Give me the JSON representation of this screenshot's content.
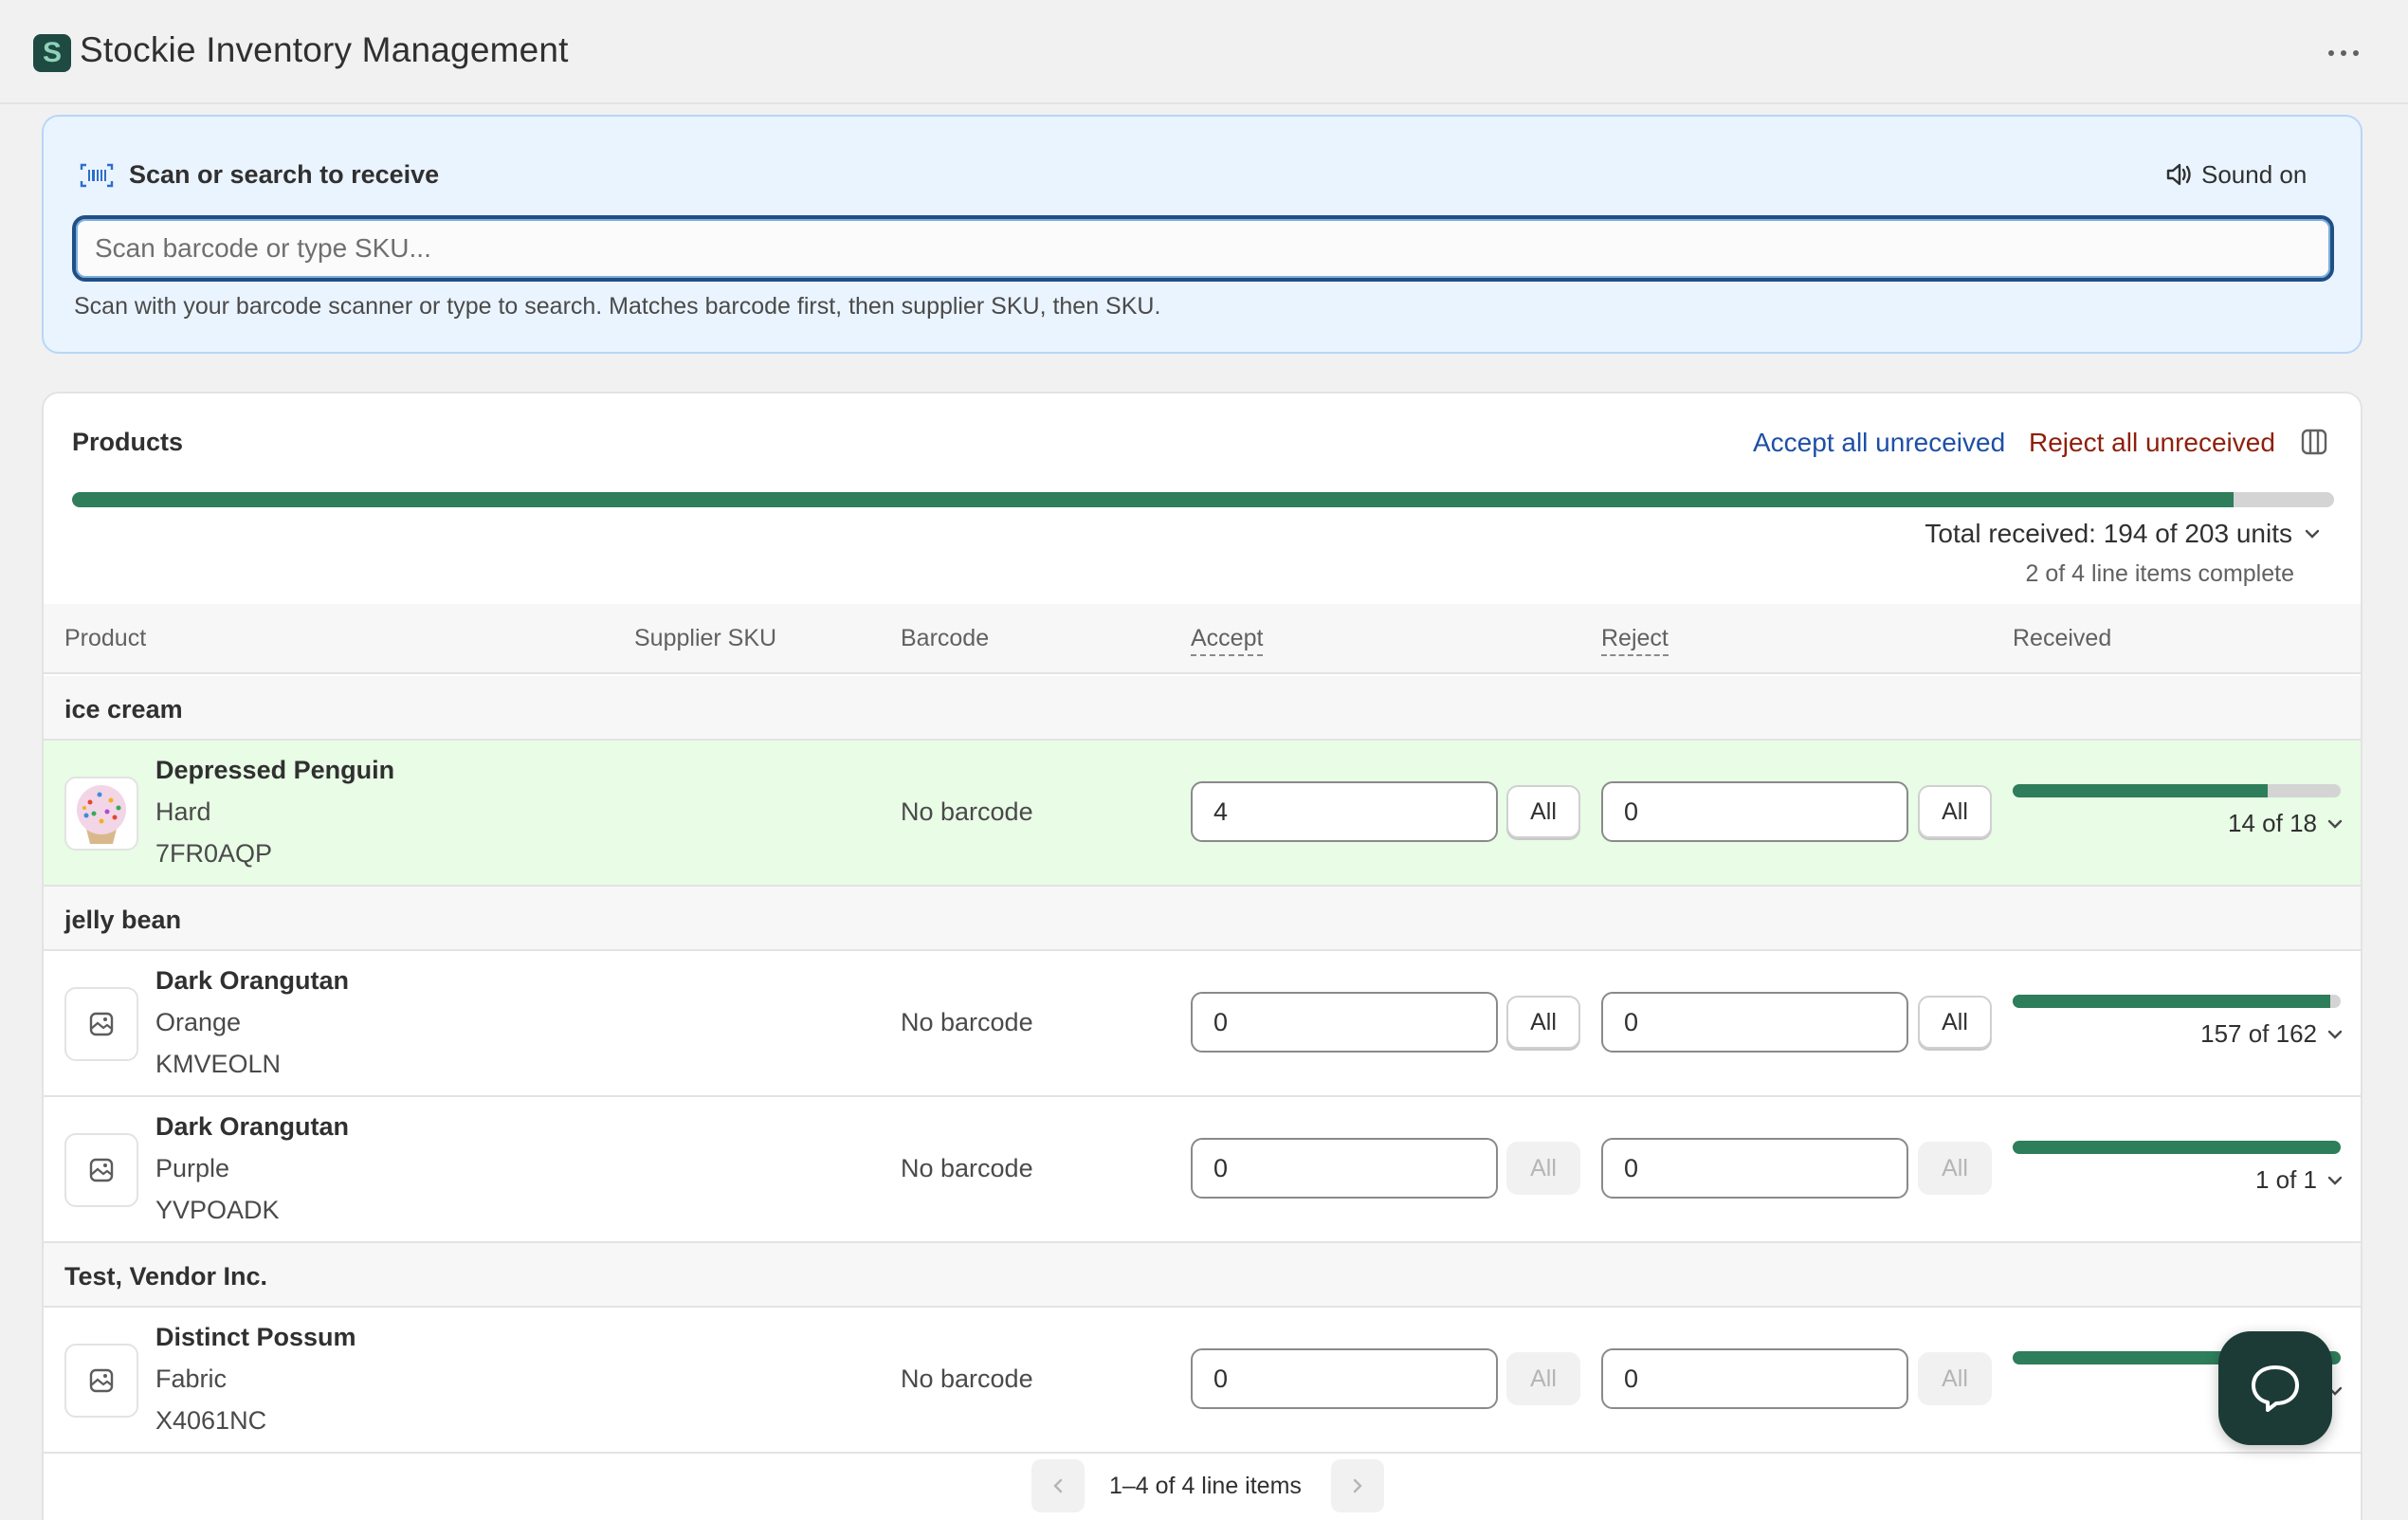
{
  "app": {
    "title": "Stockie Inventory Management",
    "logo_letter": "S"
  },
  "scan": {
    "title": "Scan or search to receive",
    "sound_label": "Sound on",
    "placeholder": "Scan barcode or type SKU...",
    "help": "Scan with your barcode scanner or type to search. Matches barcode first, then supplier SKU, then SKU."
  },
  "products": {
    "title": "Products",
    "accept_all": "Accept all unreceived",
    "reject_all": "Reject all unreceived",
    "overall_progress": 0.9557,
    "total_received": "Total received: 194 of 203 units",
    "line_items_complete": "2 of 4 line items complete",
    "columns": {
      "product": "Product",
      "supplier_sku": "Supplier SKU",
      "barcode": "Barcode",
      "accept": "Accept",
      "reject": "Reject",
      "received": "Received"
    },
    "all_label": "All",
    "groups": [
      {
        "label": "ice cream",
        "items": [
          {
            "name": "Depressed Penguin",
            "variant": "Hard",
            "sku": "7FR0AQP",
            "barcode": "No barcode",
            "accept": "4",
            "reject": "0",
            "received": "14 of 18",
            "progress": 0.7778,
            "complete": true,
            "all_enabled": true,
            "image": "cupcake"
          }
        ]
      },
      {
        "label": "jelly bean",
        "items": [
          {
            "name": "Dark Orangutan",
            "variant": "Orange",
            "sku": "KMVEOLN",
            "barcode": "No barcode",
            "accept": "0",
            "reject": "0",
            "received": "157 of 162",
            "progress": 0.9691,
            "complete": false,
            "all_enabled": true,
            "image": "placeholder"
          },
          {
            "name": "Dark Orangutan",
            "variant": "Purple",
            "sku": "YVPOADK",
            "barcode": "No barcode",
            "accept": "0",
            "reject": "0",
            "received": "1 of 1",
            "progress": 1.0,
            "complete": false,
            "all_enabled": false,
            "image": "placeholder"
          }
        ]
      },
      {
        "label": "Test, Vendor Inc.",
        "items": [
          {
            "name": "Distinct Possum",
            "variant": "Fabric",
            "sku": "X4061NC",
            "barcode": "No barcode",
            "accept": "0",
            "reject": "0",
            "received": "22 of 22",
            "progress": 1.0,
            "complete": false,
            "all_enabled": false,
            "image": "placeholder"
          }
        ]
      }
    ],
    "pagination": "1–4 of 4 line items"
  },
  "icons": {
    "more": "more-horizontal-icon",
    "barcode": "barcode-scan-icon",
    "sound": "speaker-icon",
    "columns": "columns-icon",
    "chevron": "chevron-down-icon",
    "image_placeholder": "image-placeholder-icon",
    "prev": "chevron-left-icon",
    "next": "chevron-right-icon",
    "chat": "chat-icon"
  },
  "colors": {
    "accent_green": "#2e7d5b",
    "link_blue": "#1d4fa6",
    "danger_red": "#8e1f0b",
    "complete_row": "#e8fce6",
    "scan_bg": "#eaf4ff"
  }
}
